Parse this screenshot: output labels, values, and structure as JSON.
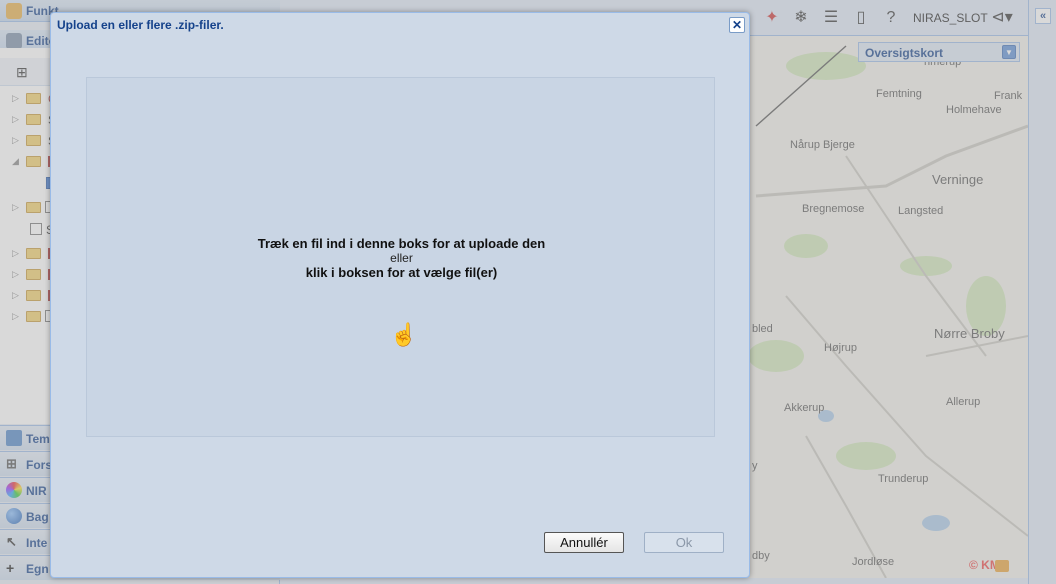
{
  "left_panel": {
    "header1": "Funkt",
    "header2": "Edito",
    "accordions": [
      {
        "label": "Tem",
        "icon": "theme-icon"
      },
      {
        "label": "Fors",
        "icon": "sitemap-icon"
      },
      {
        "label": "NIR",
        "icon": "color-wheel-icon"
      },
      {
        "label": "Bag",
        "icon": "globe-icon"
      },
      {
        "label": "Inte",
        "icon": "wand-icon"
      },
      {
        "label": "Egn",
        "icon": "plus-icon"
      }
    ],
    "tree_letters": [
      "G",
      "S",
      "S",
      "",
      "",
      "",
      "S",
      "",
      "",
      "",
      ""
    ]
  },
  "toolbar": {
    "user": "NIRAS_SLOT"
  },
  "overview": {
    "label": "Oversigtskort"
  },
  "map_labels": {
    "l1": "nmerup",
    "l2": "Femtning",
    "l3": "Frank",
    "l4": "Holmehave",
    "l5": "Nårup Bjerge",
    "l6": "Verninge",
    "l7": "Bregnemose",
    "l8": "Langsted",
    "l9": "bled",
    "l10": "Nørre Broby",
    "l11": "Højrup",
    "l12": "Akkerup",
    "l13": "Allerup",
    "l14": "y",
    "l15": "Trunderup",
    "l16": "dby",
    "l17": "Jordløse",
    "copyright": "© KMS"
  },
  "colors": {
    "accent": "#15428b",
    "panel_border": "#99bbe8",
    "modal_bg": "#ced9e7",
    "drop_bg": "#c9d5e4"
  },
  "dialog": {
    "title": "Upload en eller flere .zip-filer.",
    "drop_line1": "Træk en fil ind i denne boks for at uploade den",
    "drop_line2": "eller",
    "drop_line3": "klik i boksen for at vælge fil(er)",
    "cancel_label": "Annullér",
    "ok_label": "Ok",
    "close_glyph": "✕"
  }
}
